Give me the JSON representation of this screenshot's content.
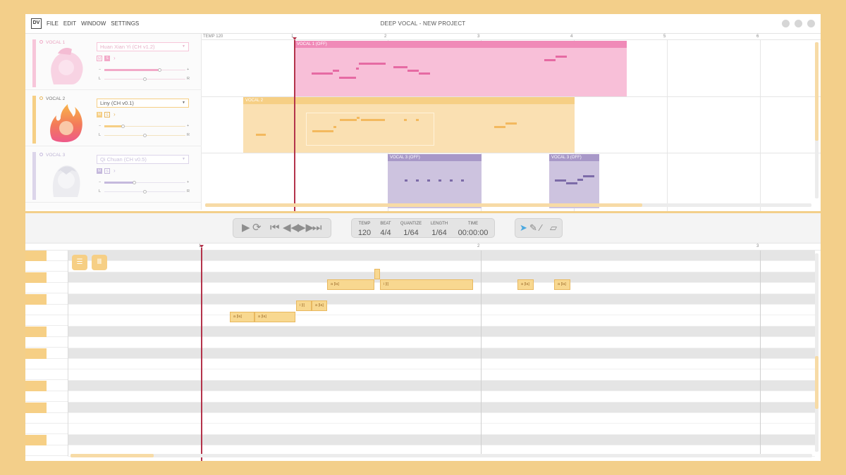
{
  "window": {
    "logo": "DV",
    "title": "DEEP VOCAL - NEW PROJECT",
    "menu": [
      "FILE",
      "EDIT",
      "WINDOW",
      "SETTINGS"
    ]
  },
  "ruler": {
    "tempo_label": "TEMP 120",
    "bars": [
      "1",
      "2",
      "3",
      "4",
      "5",
      "6"
    ]
  },
  "tracks": [
    {
      "name": "VOCAL 1",
      "singer": "Huan Xian Yi (CH v1.2)",
      "color": "#f2a9c8",
      "region_label": "VOCAL 1 (OFF)"
    },
    {
      "name": "VOCAL 2",
      "singer": "Liny (CH v0.1)",
      "color": "#f6cf85",
      "region_label": "VOCAL 2"
    },
    {
      "name": "VOCAL 3",
      "singer": "Qi Chuan (CH v0.5)",
      "color": "#c5b9dd",
      "region_label": "VOCAL 3 (OFF)",
      "region_label_2": "VOCAL 3 (OFF)"
    }
  ],
  "transport": {
    "tempo_label": "TEMP",
    "tempo_value": "120",
    "beat_label": "BEAT",
    "beat_value": "4/4",
    "quantize_label": "QUANTIZE",
    "quantize_value": "1/64",
    "length_label": "LENGTH",
    "length_value": "1/64",
    "time_label": "TIME",
    "time_value": "00:00:00"
  },
  "roll": {
    "bars": [
      "1",
      "2",
      "3"
    ],
    "notes": [
      "a [la]",
      "i [i]",
      "a [la]",
      "a [la]",
      "i [i]",
      "a [la]",
      "a [la]",
      "a [la]"
    ]
  },
  "icons": [
    "play-icon",
    "loop-icon",
    "skip-start-icon",
    "rewind-icon",
    "fast-forward-icon",
    "skip-end-icon",
    "cursor-icon",
    "pencil-icon",
    "line-icon",
    "eraser-icon",
    "list-icon",
    "piano-icon"
  ],
  "colors": {
    "accent": "#f6cf85",
    "pink": "#f2a9c8",
    "purple": "#c5b9dd",
    "playhead": "#b3334a"
  }
}
